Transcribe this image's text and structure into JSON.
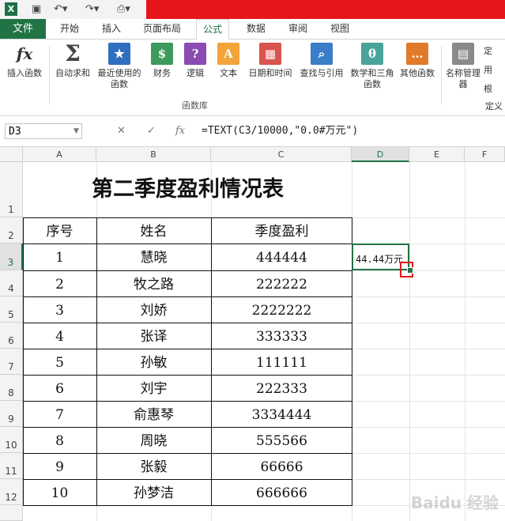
{
  "quick_access": {
    "app_icon": "X"
  },
  "tabs": [
    "文件",
    "开始",
    "插入",
    "页面布局",
    "公式",
    "数据",
    "审阅",
    "视图"
  ],
  "active_tab": "公式",
  "ribbon": {
    "buttons": [
      "插入函数",
      "自动求和",
      "最近使用的函数",
      "财务",
      "逻辑",
      "文本",
      "日期和时间",
      "查找与引用",
      "数学和三角函数",
      "其他函数",
      "名称管理器"
    ],
    "group_label": "函数库",
    "right_labels": [
      "定",
      "用",
      "根",
      "定义"
    ]
  },
  "formula_bar": {
    "name_box": "D3",
    "cancel": "✕",
    "enter": "✓",
    "fx": "fx",
    "formula": "=TEXT(C3/10000,\"0.0#万元\")"
  },
  "columns": [
    "A",
    "B",
    "C",
    "D",
    "E",
    "F"
  ],
  "rows": [
    "1",
    "2",
    "3",
    "4",
    "5",
    "6",
    "7",
    "8",
    "9",
    "10",
    "11",
    "12"
  ],
  "selected_cell": "D3",
  "sheet": {
    "title": "第二季度盈利情况表",
    "headers": [
      "序号",
      "姓名",
      "季度盈利"
    ],
    "data": [
      [
        "1",
        "慧晓",
        "444444"
      ],
      [
        "2",
        "牧之路",
        "222222"
      ],
      [
        "3",
        "刘娇",
        "2222222"
      ],
      [
        "4",
        "张译",
        "333333"
      ],
      [
        "5",
        "孙敏",
        "111111"
      ],
      [
        "6",
        "刘宇",
        "222333"
      ],
      [
        "7",
        "俞惠琴",
        "3334444"
      ],
      [
        "8",
        "周晓",
        "555566"
      ],
      [
        "9",
        "张毅",
        "66666"
      ],
      [
        "10",
        "孙梦洁",
        "666666"
      ]
    ],
    "d3_value": "44.44万元"
  },
  "watermark": "Baidu 经验",
  "colors": {
    "excel_green": "#217346",
    "red_bar": "#e8141c",
    "highlight_box": "#e21b1b"
  }
}
